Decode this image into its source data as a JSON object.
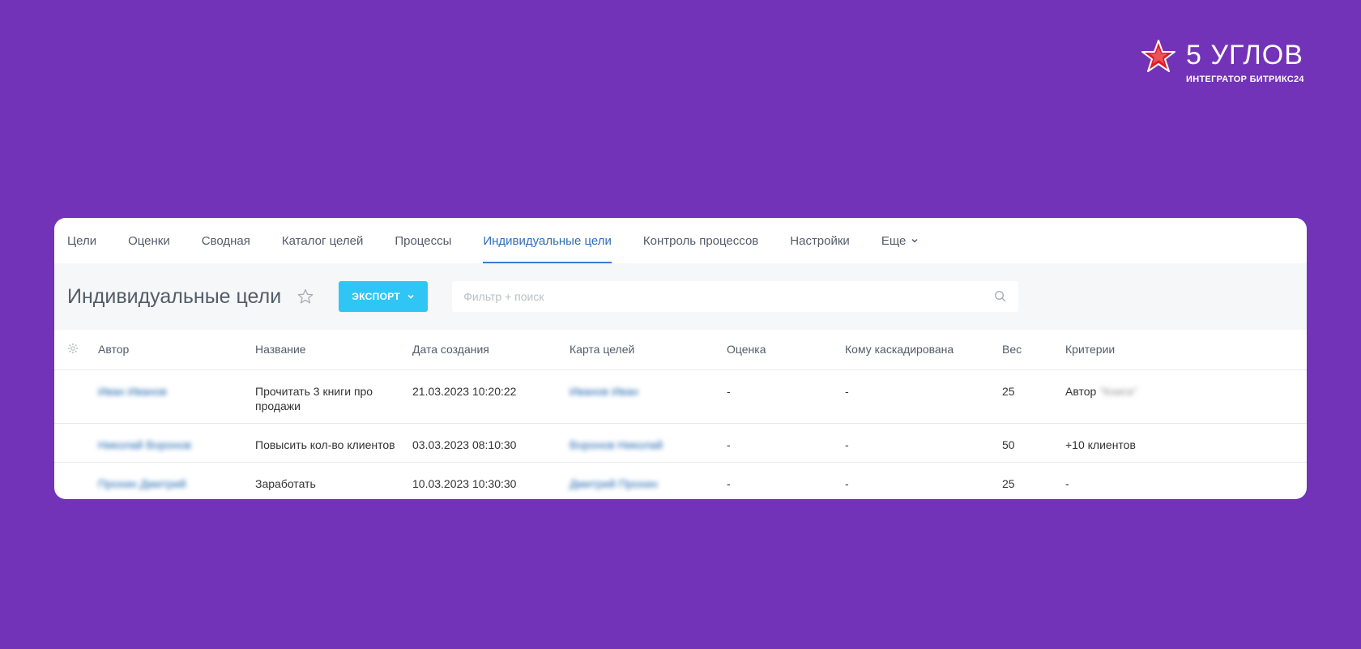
{
  "brand": {
    "name": "5 УГЛОВ",
    "subtitle": "ИНТЕГРАТОР БИТРИКС24",
    "icon": "star-logo-icon",
    "colors": {
      "logo_red": "#e21b23",
      "background": "#7333b8"
    }
  },
  "tabs": [
    {
      "label": "Цели"
    },
    {
      "label": "Оценки"
    },
    {
      "label": "Сводная"
    },
    {
      "label": "Каталог целей"
    },
    {
      "label": "Процессы"
    },
    {
      "label": "Индивидуальные цели",
      "active": true
    },
    {
      "label": "Контроль процессов"
    },
    {
      "label": "Настройки"
    },
    {
      "label": "Еще"
    }
  ],
  "toolbar": {
    "title": "Индивидуальные цели",
    "export_label": "ЭКСПОРТ",
    "search_placeholder": "Фильтр + поиск",
    "accent": "#2fc6f6"
  },
  "table": {
    "columns": [
      "Автор",
      "Название",
      "Дата создания",
      "Карта целей",
      "Оценка",
      "Кому каскадирована",
      "Вес",
      "Критерии"
    ],
    "rows": [
      {
        "author": "Иван Иванов",
        "name_line1": "Прочитать 3 книги про",
        "name_line2": "продажи",
        "created": "21.03.2023 10:20:22",
        "goal_map": "Иванов Иван",
        "rating": "-",
        "cascaded_to": "-",
        "weight": "25",
        "criteria": "Автор",
        "criteria_extra": "\"Книга\""
      },
      {
        "author": "Николай Воронов",
        "name_line1": "Повысить кол-во клиентов",
        "created": "03.03.2023 08:10:30",
        "goal_map": "Воронов Николай",
        "rating": "-",
        "cascaded_to": "-",
        "weight": "50",
        "criteria": "+10 клиентов"
      },
      {
        "author": "Прохин Дмитрий",
        "name_line1": "Заработать",
        "created": "10.03.2023 10:30:30",
        "goal_map": "Дмитрий Прохин",
        "rating": "-",
        "cascaded_to": "-",
        "weight": "25",
        "criteria": "-"
      }
    ]
  }
}
